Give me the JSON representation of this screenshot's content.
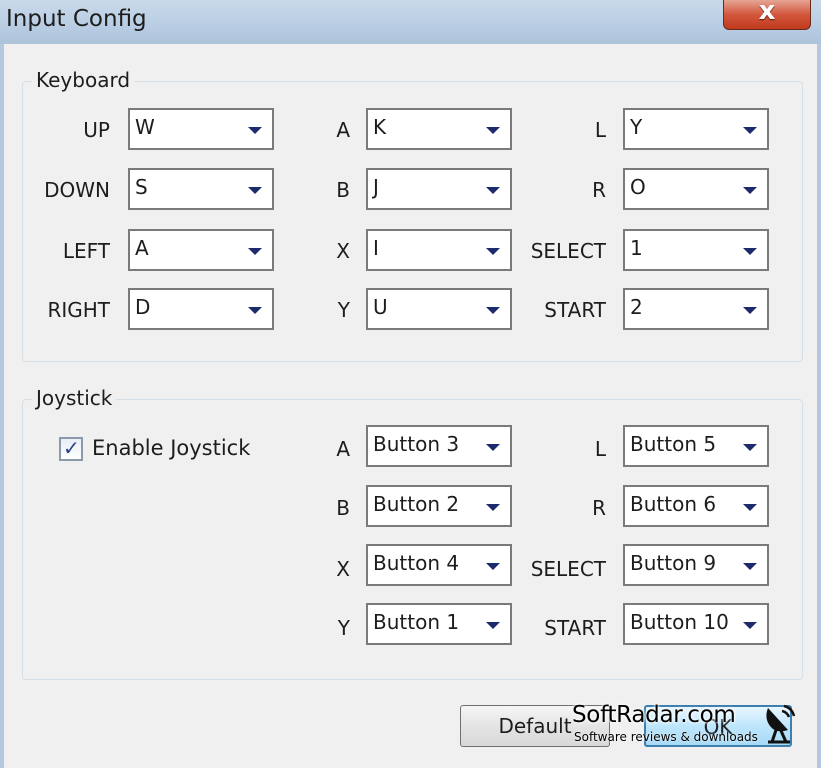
{
  "window": {
    "title": "Input Config",
    "close_label": "x"
  },
  "keyboard": {
    "legend": "Keyboard",
    "rows": [
      {
        "l1": "UP",
        "v1": "W",
        "l2": "A",
        "v2": "K",
        "l3": "L",
        "v3": "Y"
      },
      {
        "l1": "DOWN",
        "v1": "S",
        "l2": "B",
        "v2": "J",
        "l3": "R",
        "v3": "O"
      },
      {
        "l1": "LEFT",
        "v1": "A",
        "l2": "X",
        "v2": "I",
        "l3": "SELECT",
        "v3": "1"
      },
      {
        "l1": "RIGHT",
        "v1": "D",
        "l2": "Y",
        "v2": "U",
        "l3": "START",
        "v3": "2"
      }
    ]
  },
  "joystick": {
    "legend": "Joystick",
    "enable_label": "Enable Joystick",
    "enabled": true,
    "rows": [
      {
        "l2": "A",
        "v2": "Button 3",
        "l3": "L",
        "v3": "Button 5"
      },
      {
        "l2": "B",
        "v2": "Button 2",
        "l3": "R",
        "v3": "Button 6"
      },
      {
        "l2": "X",
        "v2": "Button 4",
        "l3": "SELECT",
        "v3": "Button 9"
      },
      {
        "l2": "Y",
        "v2": "Button 1",
        "l3": "START",
        "v3": "Button 10"
      }
    ]
  },
  "buttons": {
    "default_label": "Default",
    "ok_label": "OK"
  },
  "watermark": {
    "brand": "SoftRadar.com",
    "tagline": "Software reviews & downloads"
  }
}
